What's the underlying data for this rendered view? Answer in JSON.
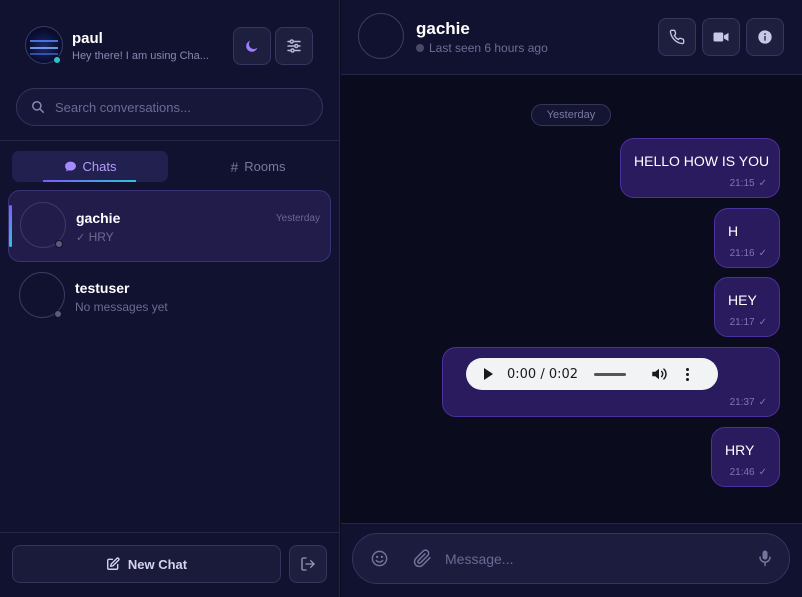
{
  "sidebar": {
    "user": {
      "name": "paul",
      "bio": "Hey there! I am using Cha..."
    },
    "search": {
      "placeholder": "Search conversations..."
    },
    "tabs": [
      {
        "label": "Chats",
        "icon": "chat-bubble-icon",
        "active": true
      },
      {
        "label": "Rooms",
        "icon": "hash-icon",
        "active": false
      }
    ],
    "conversations": [
      {
        "name": "gachie",
        "preview": "HRY",
        "time": "Yesterday",
        "active": true,
        "read": true
      },
      {
        "name": "testuser",
        "preview": "No messages yet",
        "time": "",
        "active": false,
        "read": false
      }
    ],
    "new_chat_label": "New Chat"
  },
  "chat": {
    "peer": {
      "name": "gachie",
      "status": "Last seen 6 hours ago"
    },
    "day_separator": "Yesterday",
    "messages": [
      {
        "type": "text",
        "text": "HELLO HOW IS YOU",
        "time": "21:15"
      },
      {
        "type": "text",
        "text": "H",
        "time": "21:16"
      },
      {
        "type": "text",
        "text": "HEY",
        "time": "21:17"
      },
      {
        "type": "audio",
        "timecode": "0:00 / 0:02",
        "progress": 0,
        "time": "21:37"
      },
      {
        "type": "text",
        "text": "HRY",
        "time": "21:46"
      }
    ],
    "composer": {
      "placeholder": "Message..."
    }
  },
  "colors": {
    "background": "#0b0b1e",
    "panel": "#111130",
    "accent_purple": "#7c5cff",
    "accent_cyan": "#2fc3d6",
    "bubble": "#2a1a5e",
    "bubble_border": "#4a32a0"
  }
}
